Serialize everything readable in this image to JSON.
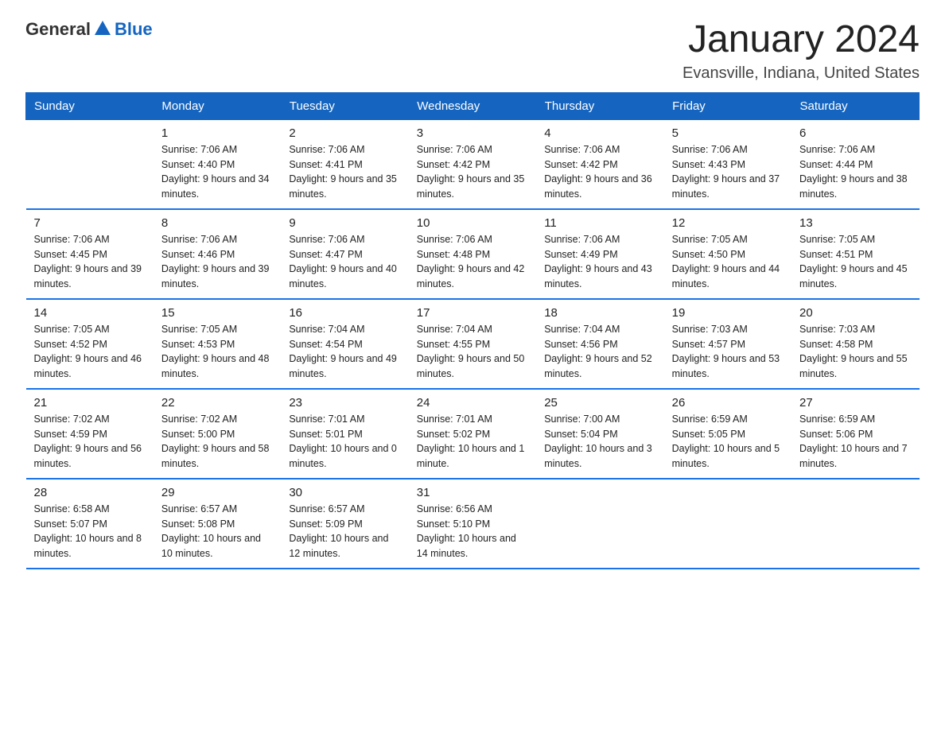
{
  "header": {
    "logo_general": "General",
    "logo_blue": "Blue",
    "title": "January 2024",
    "subtitle": "Evansville, Indiana, United States"
  },
  "days_of_week": [
    "Sunday",
    "Monday",
    "Tuesday",
    "Wednesday",
    "Thursday",
    "Friday",
    "Saturday"
  ],
  "weeks": [
    [
      {
        "day": "",
        "sunrise": "",
        "sunset": "",
        "daylight": ""
      },
      {
        "day": "1",
        "sunrise": "Sunrise: 7:06 AM",
        "sunset": "Sunset: 4:40 PM",
        "daylight": "Daylight: 9 hours and 34 minutes."
      },
      {
        "day": "2",
        "sunrise": "Sunrise: 7:06 AM",
        "sunset": "Sunset: 4:41 PM",
        "daylight": "Daylight: 9 hours and 35 minutes."
      },
      {
        "day": "3",
        "sunrise": "Sunrise: 7:06 AM",
        "sunset": "Sunset: 4:42 PM",
        "daylight": "Daylight: 9 hours and 35 minutes."
      },
      {
        "day": "4",
        "sunrise": "Sunrise: 7:06 AM",
        "sunset": "Sunset: 4:42 PM",
        "daylight": "Daylight: 9 hours and 36 minutes."
      },
      {
        "day": "5",
        "sunrise": "Sunrise: 7:06 AM",
        "sunset": "Sunset: 4:43 PM",
        "daylight": "Daylight: 9 hours and 37 minutes."
      },
      {
        "day": "6",
        "sunrise": "Sunrise: 7:06 AM",
        "sunset": "Sunset: 4:44 PM",
        "daylight": "Daylight: 9 hours and 38 minutes."
      }
    ],
    [
      {
        "day": "7",
        "sunrise": "Sunrise: 7:06 AM",
        "sunset": "Sunset: 4:45 PM",
        "daylight": "Daylight: 9 hours and 39 minutes."
      },
      {
        "day": "8",
        "sunrise": "Sunrise: 7:06 AM",
        "sunset": "Sunset: 4:46 PM",
        "daylight": "Daylight: 9 hours and 39 minutes."
      },
      {
        "day": "9",
        "sunrise": "Sunrise: 7:06 AM",
        "sunset": "Sunset: 4:47 PM",
        "daylight": "Daylight: 9 hours and 40 minutes."
      },
      {
        "day": "10",
        "sunrise": "Sunrise: 7:06 AM",
        "sunset": "Sunset: 4:48 PM",
        "daylight": "Daylight: 9 hours and 42 minutes."
      },
      {
        "day": "11",
        "sunrise": "Sunrise: 7:06 AM",
        "sunset": "Sunset: 4:49 PM",
        "daylight": "Daylight: 9 hours and 43 minutes."
      },
      {
        "day": "12",
        "sunrise": "Sunrise: 7:05 AM",
        "sunset": "Sunset: 4:50 PM",
        "daylight": "Daylight: 9 hours and 44 minutes."
      },
      {
        "day": "13",
        "sunrise": "Sunrise: 7:05 AM",
        "sunset": "Sunset: 4:51 PM",
        "daylight": "Daylight: 9 hours and 45 minutes."
      }
    ],
    [
      {
        "day": "14",
        "sunrise": "Sunrise: 7:05 AM",
        "sunset": "Sunset: 4:52 PM",
        "daylight": "Daylight: 9 hours and 46 minutes."
      },
      {
        "day": "15",
        "sunrise": "Sunrise: 7:05 AM",
        "sunset": "Sunset: 4:53 PM",
        "daylight": "Daylight: 9 hours and 48 minutes."
      },
      {
        "day": "16",
        "sunrise": "Sunrise: 7:04 AM",
        "sunset": "Sunset: 4:54 PM",
        "daylight": "Daylight: 9 hours and 49 minutes."
      },
      {
        "day": "17",
        "sunrise": "Sunrise: 7:04 AM",
        "sunset": "Sunset: 4:55 PM",
        "daylight": "Daylight: 9 hours and 50 minutes."
      },
      {
        "day": "18",
        "sunrise": "Sunrise: 7:04 AM",
        "sunset": "Sunset: 4:56 PM",
        "daylight": "Daylight: 9 hours and 52 minutes."
      },
      {
        "day": "19",
        "sunrise": "Sunrise: 7:03 AM",
        "sunset": "Sunset: 4:57 PM",
        "daylight": "Daylight: 9 hours and 53 minutes."
      },
      {
        "day": "20",
        "sunrise": "Sunrise: 7:03 AM",
        "sunset": "Sunset: 4:58 PM",
        "daylight": "Daylight: 9 hours and 55 minutes."
      }
    ],
    [
      {
        "day": "21",
        "sunrise": "Sunrise: 7:02 AM",
        "sunset": "Sunset: 4:59 PM",
        "daylight": "Daylight: 9 hours and 56 minutes."
      },
      {
        "day": "22",
        "sunrise": "Sunrise: 7:02 AM",
        "sunset": "Sunset: 5:00 PM",
        "daylight": "Daylight: 9 hours and 58 minutes."
      },
      {
        "day": "23",
        "sunrise": "Sunrise: 7:01 AM",
        "sunset": "Sunset: 5:01 PM",
        "daylight": "Daylight: 10 hours and 0 minutes."
      },
      {
        "day": "24",
        "sunrise": "Sunrise: 7:01 AM",
        "sunset": "Sunset: 5:02 PM",
        "daylight": "Daylight: 10 hours and 1 minute."
      },
      {
        "day": "25",
        "sunrise": "Sunrise: 7:00 AM",
        "sunset": "Sunset: 5:04 PM",
        "daylight": "Daylight: 10 hours and 3 minutes."
      },
      {
        "day": "26",
        "sunrise": "Sunrise: 6:59 AM",
        "sunset": "Sunset: 5:05 PM",
        "daylight": "Daylight: 10 hours and 5 minutes."
      },
      {
        "day": "27",
        "sunrise": "Sunrise: 6:59 AM",
        "sunset": "Sunset: 5:06 PM",
        "daylight": "Daylight: 10 hours and 7 minutes."
      }
    ],
    [
      {
        "day": "28",
        "sunrise": "Sunrise: 6:58 AM",
        "sunset": "Sunset: 5:07 PM",
        "daylight": "Daylight: 10 hours and 8 minutes."
      },
      {
        "day": "29",
        "sunrise": "Sunrise: 6:57 AM",
        "sunset": "Sunset: 5:08 PM",
        "daylight": "Daylight: 10 hours and 10 minutes."
      },
      {
        "day": "30",
        "sunrise": "Sunrise: 6:57 AM",
        "sunset": "Sunset: 5:09 PM",
        "daylight": "Daylight: 10 hours and 12 minutes."
      },
      {
        "day": "31",
        "sunrise": "Sunrise: 6:56 AM",
        "sunset": "Sunset: 5:10 PM",
        "daylight": "Daylight: 10 hours and 14 minutes."
      },
      {
        "day": "",
        "sunrise": "",
        "sunset": "",
        "daylight": ""
      },
      {
        "day": "",
        "sunrise": "",
        "sunset": "",
        "daylight": ""
      },
      {
        "day": "",
        "sunrise": "",
        "sunset": "",
        "daylight": ""
      }
    ]
  ]
}
